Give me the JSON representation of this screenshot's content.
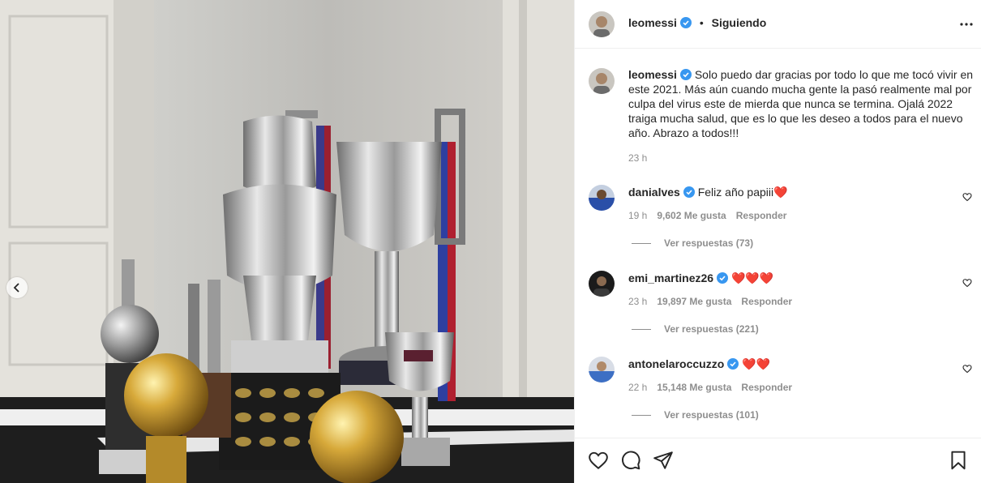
{
  "post": {
    "username": "leomessi",
    "follow_status": "Siguiendo",
    "caption": "Solo puedo dar gracias por todo lo que me tocó vivir en este 2021. Más aún cuando mucha gente la pasó realmente mal por culpa del virus este de mierda que nunca se termina. Ojalá 2022 traiga mucha salud, que es lo que les deseo a todos para el nuevo año. Abrazo a todos!!!",
    "time": "23 h"
  },
  "comments": [
    {
      "username": "danialves",
      "text": "Feliz año papiii",
      "emoji": "❤️",
      "time": "19 h",
      "likes": "9,602 Me gusta",
      "reply_label": "Responder",
      "replies": "Ver respuestas (73)"
    },
    {
      "username": "emi_martinez26",
      "text": "",
      "emoji": "❤️❤️❤️",
      "time": "23 h",
      "likes": "19,897 Me gusta",
      "reply_label": "Responder",
      "replies": "Ver respuestas (221)"
    },
    {
      "username": "antonelaroccuzzo",
      "text": "",
      "emoji": "❤️❤️",
      "time": "22 h",
      "likes": "15,148 Me gusta",
      "reply_label": "Responder",
      "replies": "Ver respuestas (101)"
    }
  ],
  "icons": {
    "prev": "chevron-left-icon",
    "more": "more-horizontal-icon",
    "like": "heart-icon",
    "comment": "comment-icon",
    "share": "paper-plane-icon",
    "save": "bookmark-icon",
    "verified": "verified-badge-icon"
  },
  "colors": {
    "verified": "#3897f0",
    "meta": "#8e8e8e",
    "heart": "#ed4956"
  }
}
